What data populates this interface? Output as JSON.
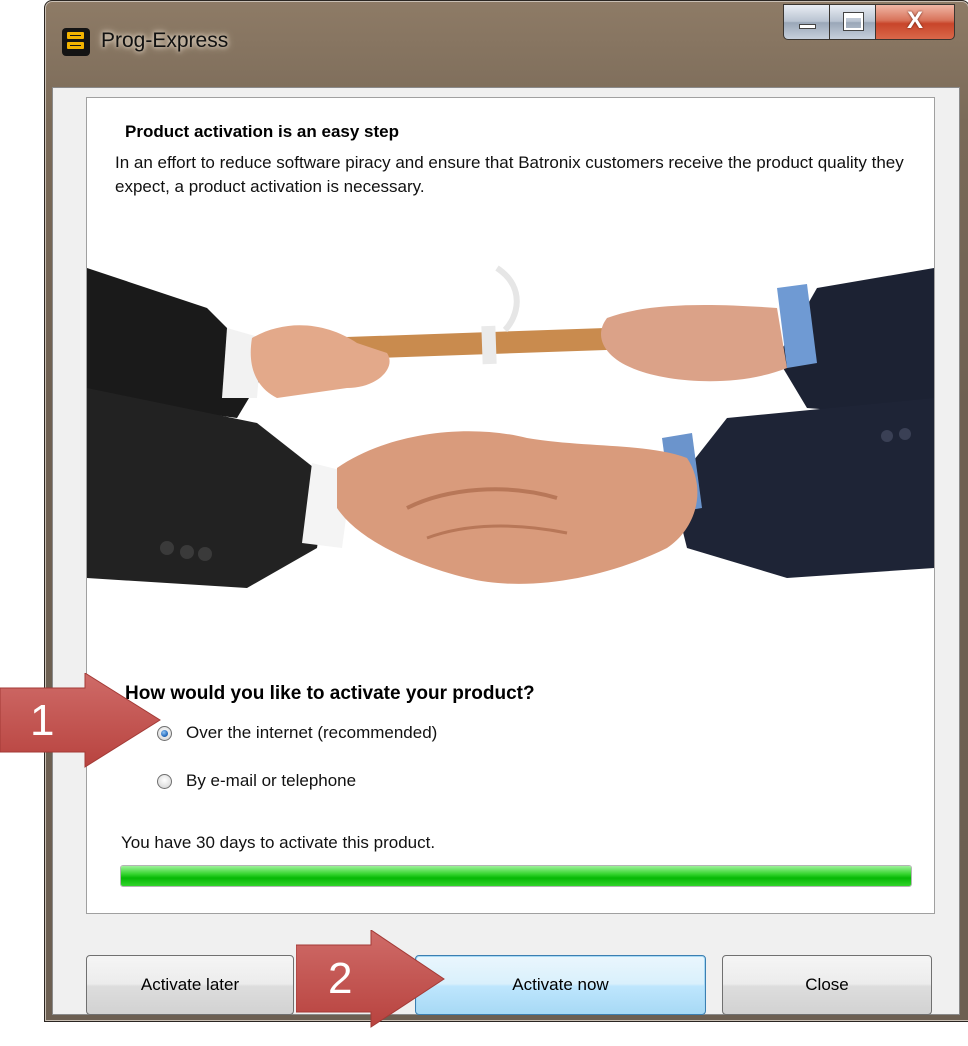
{
  "window": {
    "title": "Prog-Express",
    "caption_buttons": {
      "minimize_icon": "minimize-icon",
      "maximize_icon": "maximize-icon",
      "close_glyph": "X"
    }
  },
  "panel": {
    "heading": "Product activation is an easy step",
    "intro": "In an effort to reduce software piracy and ensure that Batronix customers receive the product quality they expect, a product activation is necessary.",
    "question": "How would you like to activate your product?",
    "options": [
      {
        "label": "Over the internet (recommended)",
        "selected": true
      },
      {
        "label": "By e-mail or telephone",
        "selected": false
      }
    ],
    "countdown_text": "You have 30 days to activate this product.",
    "progress_fraction": 1.0
  },
  "buttons": {
    "activate_later": "Activate later",
    "activate_now": "Activate now",
    "close": "Close"
  },
  "callouts": [
    "1",
    "2"
  ],
  "colors": {
    "callout_fill": "#c0504d",
    "progress_green": "#06b806"
  }
}
